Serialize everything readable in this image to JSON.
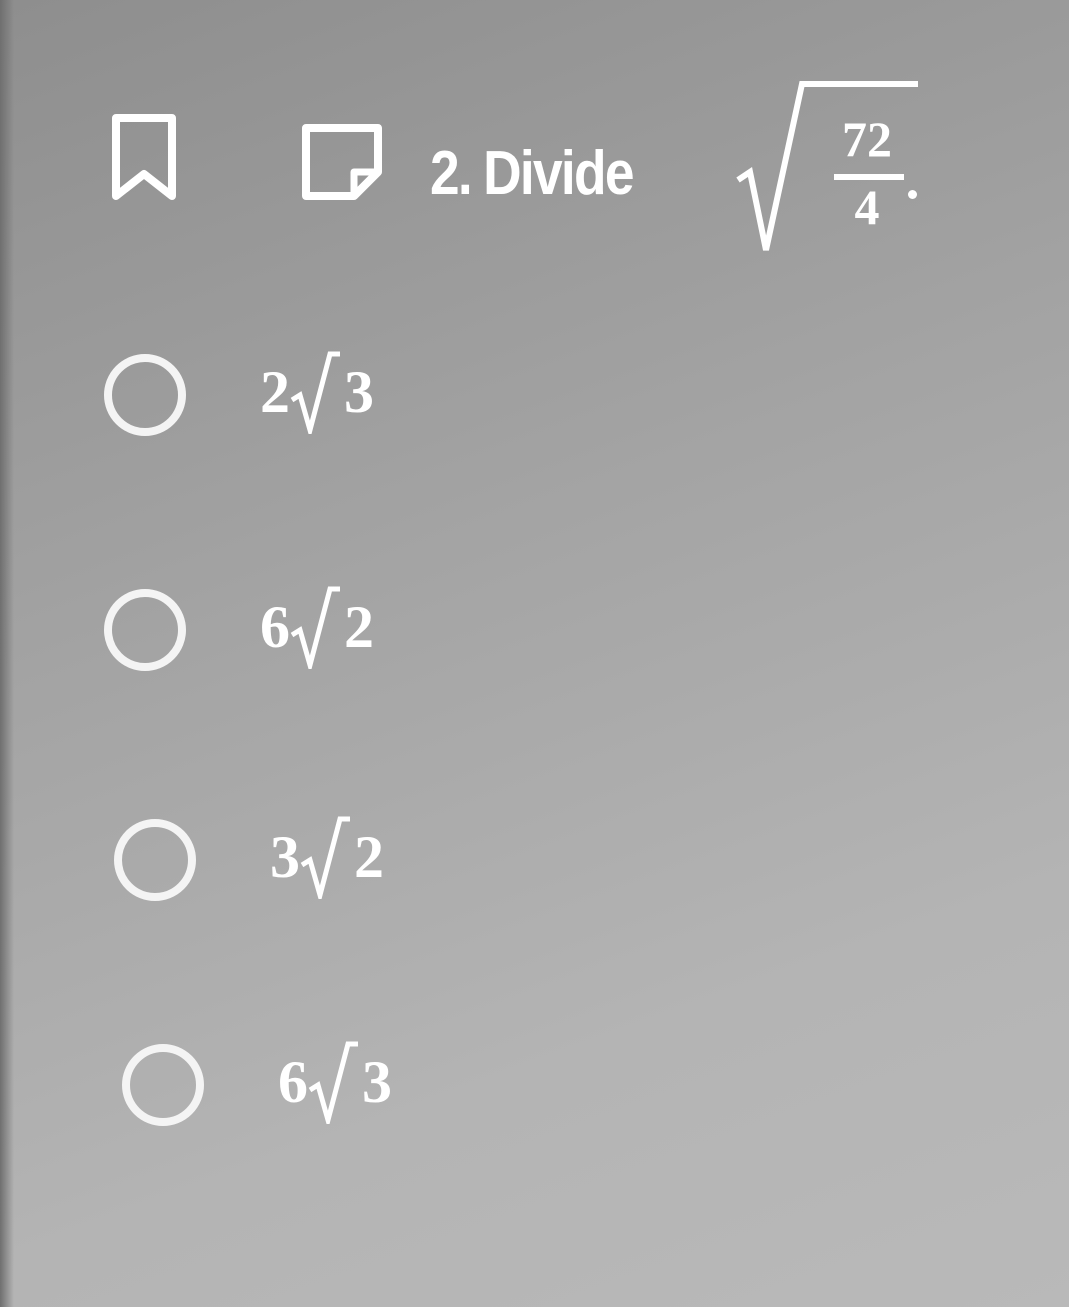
{
  "question": {
    "number": "2.",
    "prompt": "Divide",
    "numerator": "72",
    "denominator": "4",
    "icons": [
      "bookmark-icon",
      "note-icon"
    ]
  },
  "options": [
    {
      "coefficient": "2",
      "radicand": "3"
    },
    {
      "coefficient": "6",
      "radicand": "2"
    },
    {
      "coefficient": "3",
      "radicand": "2"
    },
    {
      "coefficient": "6",
      "radicand": "3"
    }
  ],
  "colors": {
    "text": "#ffffff",
    "background": "#a3a3a3"
  }
}
